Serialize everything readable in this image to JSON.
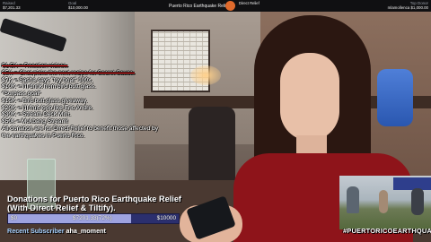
{
  "topbar": {
    "left_label": "Raised",
    "left_value": "$7,201.33",
    "mid_label": "Goal",
    "mid_value": "$10,000.00",
    "title": "Puerto Rico Earthquake Relief",
    "partner_logo_label": "Direct Relief",
    "right_label": "Top Donor",
    "right_value": "mlamollenca $1,000.00"
  },
  "goals": [
    {
      "text": "$1.5K = Reaction videos.",
      "done": true
    },
    {
      "text": "$5K = Chat picks the next recipe for Secret Sauce.",
      "done": true
    },
    {
      "text": "$7K = Sasha says \"toy boat\" 100x,",
      "done": false
    },
    {
      "text": "$10K = I'll drink from bird butt glass.",
      "done": false
    },
    {
      "text": "*Surpass goal*",
      "done": false
    },
    {
      "text": "$15K = Bird butt glass giveaway.",
      "done": false
    },
    {
      "text": "$20K = I'll fruit loop like Eric Andre.",
      "done": false
    },
    {
      "text": "$30K = Stream Deck Mini.",
      "done": false
    },
    {
      "text": "$50k = Mukbang Stream!",
      "done": false
    },
    {
      "text": "All donation are for Direct Relief to benefit those affected by",
      "done": false
    },
    {
      "text": "the earthquakes in Puerto Rico.",
      "done": false
    }
  ],
  "donation": {
    "title": "Donations for Puerto Rico Earthquake Relief (With Direct Relief & Tiltify).",
    "bar_min": "$0",
    "bar_current": "$7201.33(72%)",
    "bar_max": "$10000",
    "progress_fraction": 0.72
  },
  "recent_subscriber": {
    "label": "Recent Subscriber",
    "name": "aha_moment"
  },
  "hashtag": "#PUERTORICOEARTHQUAKES",
  "colors": {
    "bar_background": "#2b2f6e",
    "bar_fill": "#9ea3e0",
    "strike_red": "#ff3030"
  }
}
